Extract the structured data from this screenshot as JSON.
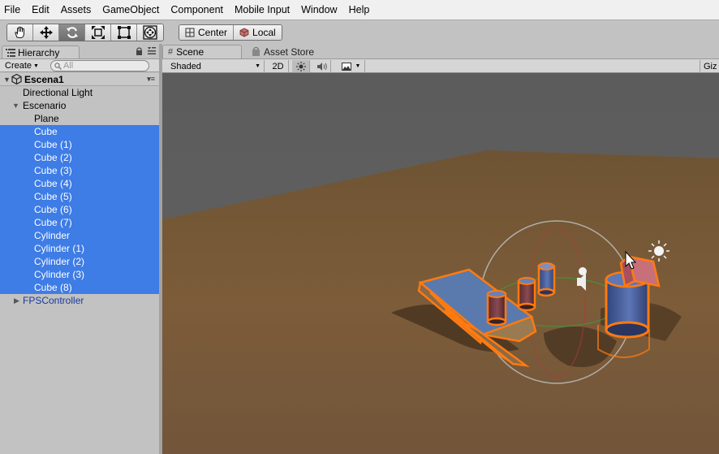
{
  "menu": [
    "File",
    "Edit",
    "Assets",
    "GameObject",
    "Component",
    "Mobile Input",
    "Window",
    "Help"
  ],
  "toolbar": {
    "tools": [
      {
        "icon": "hand-icon"
      },
      {
        "icon": "move-icon"
      },
      {
        "icon": "rotate-icon",
        "active": true
      },
      {
        "icon": "scale-icon"
      },
      {
        "icon": "rect-tool-icon"
      },
      {
        "icon": "transform-tool-icon"
      }
    ],
    "pivot_label": "Center",
    "space_label": "Local"
  },
  "hierarchy": {
    "tab_label": "Hierarchy",
    "create_label": "Create",
    "search_placeholder": "All",
    "scene_name": "Escena1",
    "rows": [
      {
        "label": "Directional Light",
        "indent": 1,
        "selected": false
      },
      {
        "label": "Escenario",
        "indent": 1,
        "selected": false,
        "expanded": true
      },
      {
        "label": "Plane",
        "indent": 2,
        "selected": false
      },
      {
        "label": "Cube",
        "indent": 2,
        "selected": true
      },
      {
        "label": "Cube (1)",
        "indent": 2,
        "selected": true
      },
      {
        "label": "Cube (2)",
        "indent": 2,
        "selected": true
      },
      {
        "label": "Cube (3)",
        "indent": 2,
        "selected": true
      },
      {
        "label": "Cube (4)",
        "indent": 2,
        "selected": true
      },
      {
        "label": "Cube (5)",
        "indent": 2,
        "selected": true
      },
      {
        "label": "Cube (6)",
        "indent": 2,
        "selected": true
      },
      {
        "label": "Cube (7)",
        "indent": 2,
        "selected": true
      },
      {
        "label": "Cylinder",
        "indent": 2,
        "selected": true
      },
      {
        "label": "Cylinder (1)",
        "indent": 2,
        "selected": true
      },
      {
        "label": "Cylinder (2)",
        "indent": 2,
        "selected": true
      },
      {
        "label": "Cylinder (3)",
        "indent": 2,
        "selected": true
      },
      {
        "label": "Cube (8)",
        "indent": 2,
        "selected": true
      },
      {
        "label": "FPSController",
        "indent": 1,
        "selected": false,
        "collapsed": true
      }
    ]
  },
  "scene": {
    "tab_label": "Scene",
    "store_tab_label": "Asset Store",
    "shading_mode": "Shaded",
    "mode_2d_label": "2D",
    "gizmos_label": "Giz"
  },
  "colors": {
    "selection": "#3e7ce6",
    "ground": "#7a5a38",
    "sky": "#5a5a5a",
    "outline": "#ff6a00"
  }
}
